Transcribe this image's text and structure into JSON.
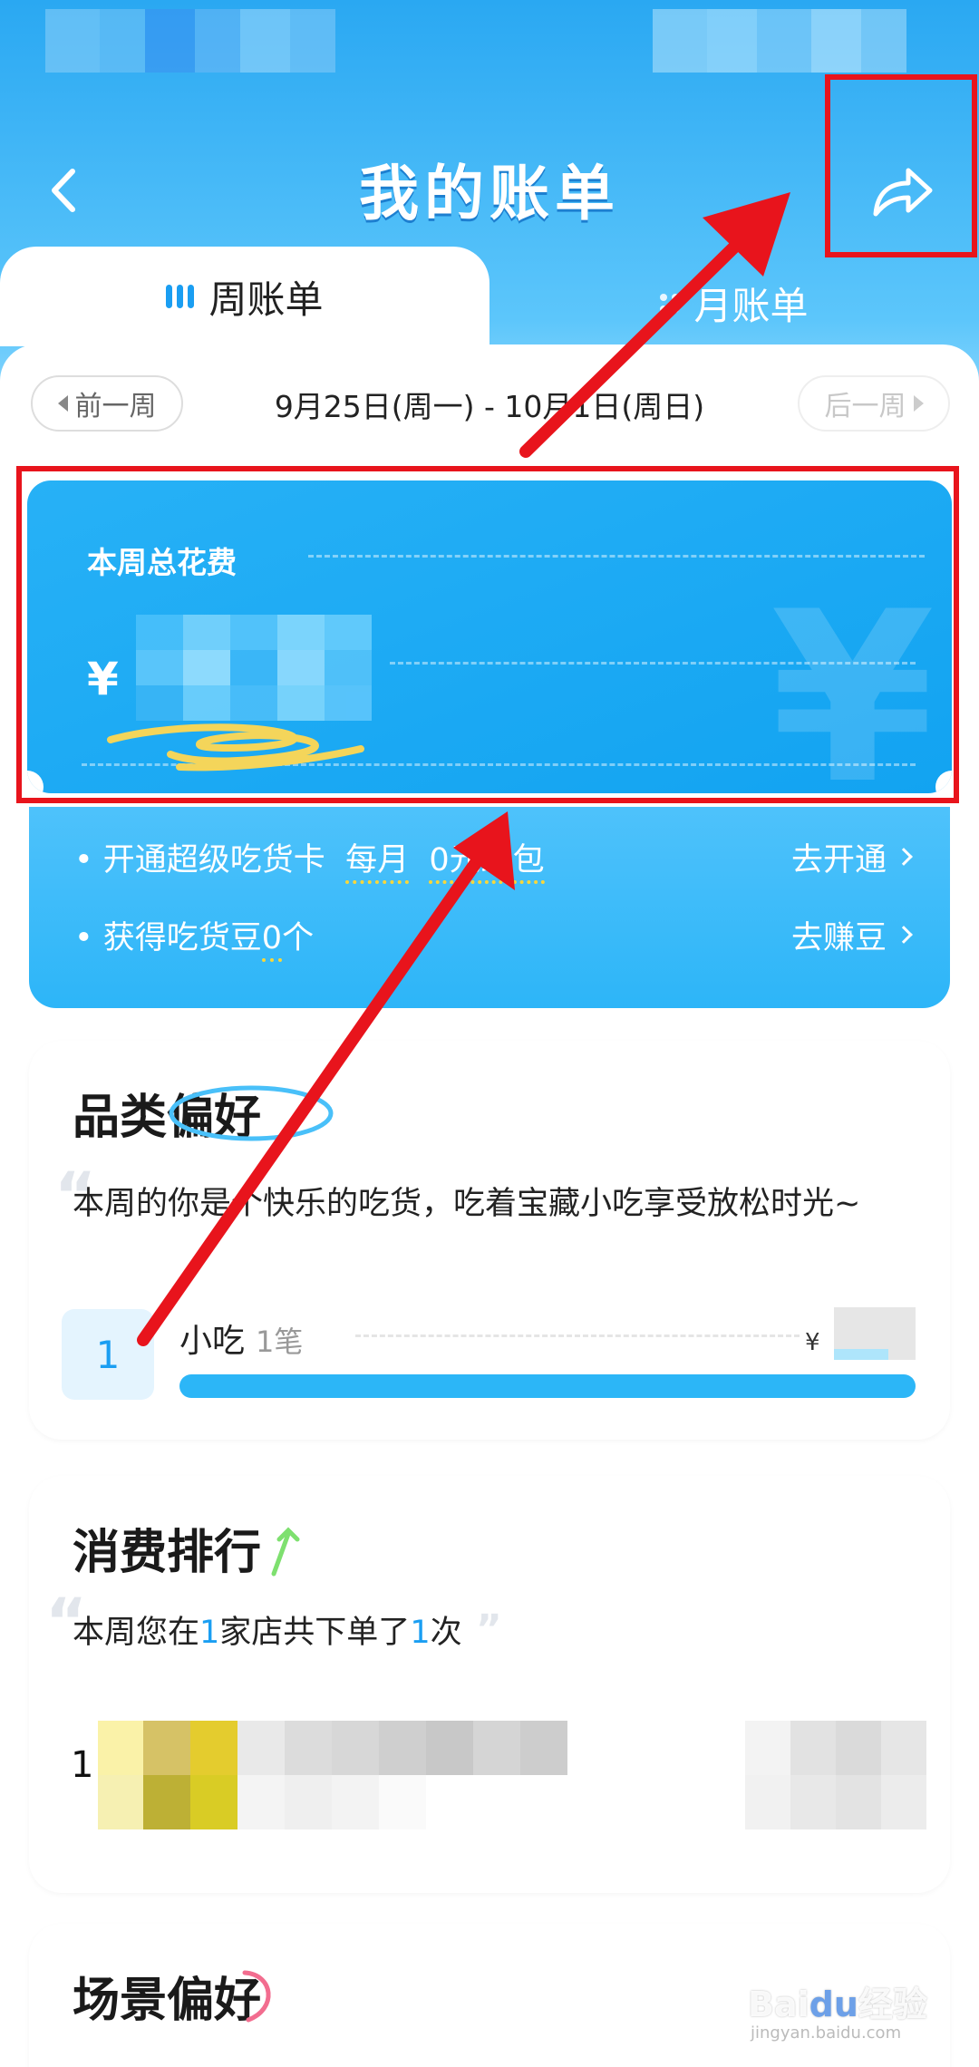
{
  "header": {
    "title": "我的账单"
  },
  "tabs": [
    {
      "label": "周账单",
      "active": true
    },
    {
      "label": "月账单",
      "active": false
    }
  ],
  "week_nav": {
    "prev_label": "前一周",
    "range": "9月25日(周一)  -  10月1日(周日)",
    "next_label": "后一周"
  },
  "spend_card": {
    "label": "本周总花费",
    "currency": "¥"
  },
  "promo": {
    "row1_text_a": "开通超级吃货卡",
    "row1_text_b": "每月",
    "row1_text_c": "0元红包",
    "row1_link": "去开通",
    "row2_text_a": "获得吃货豆",
    "row2_count": "0",
    "row2_text_b": "个",
    "row2_link": "去赚豆"
  },
  "category_pref": {
    "title": "品类偏好",
    "desc": "本周的你是个快乐的吃货，吃着宝藏小吃享受放松时光~",
    "items": [
      {
        "rank": "1",
        "name": "小吃",
        "count": "1笔",
        "currency": "¥",
        "share": 1.0
      }
    ]
  },
  "spending_rank": {
    "title": "消费排行",
    "desc_a": "本周您在",
    "desc_shops": "1",
    "desc_b": "家店共下单了",
    "desc_orders": "1",
    "desc_c": "次",
    "items": [
      {
        "rank": "1"
      }
    ]
  },
  "scene_pref": {
    "title": "场景偏好"
  },
  "watermark": {
    "main": "Baidu经验",
    "sub": "jingyan.baidu.com"
  },
  "colors": {
    "accent": "#1a9ef2",
    "header_bg": "#2aa8f2",
    "annotation": "#e8141c"
  }
}
